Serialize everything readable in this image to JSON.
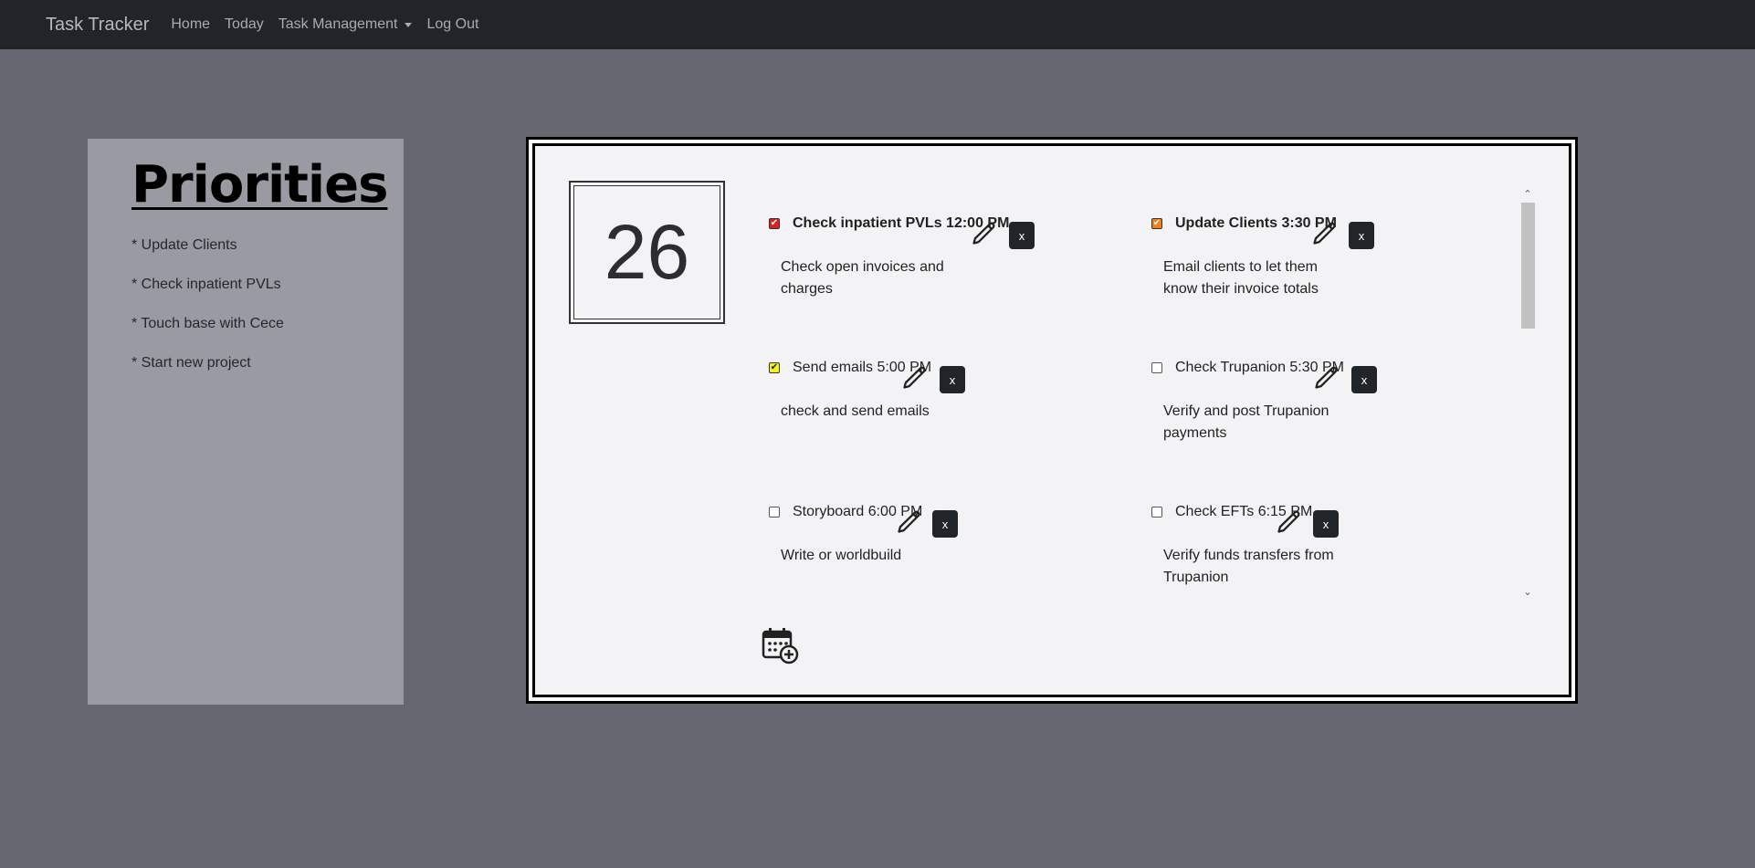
{
  "nav": {
    "brand": "Task Tracker",
    "links": [
      "Home",
      "Today",
      "Task Management",
      "Log Out"
    ]
  },
  "priorities": {
    "title": "Priorities",
    "items": [
      "* Update Clients",
      "* Check inpatient PVLs",
      "* Touch base with Cece",
      "* Start new project"
    ]
  },
  "day": "26",
  "tasks": [
    {
      "title": "Check inpatient PVLs 12:00 PM",
      "desc": "Check open invoices and charges",
      "checked": true,
      "check_color": "#dc1f1f",
      "bold": true
    },
    {
      "title": "Update Clients 3:30 PM",
      "desc": "Email clients to let them know their invoice totals",
      "checked": true,
      "check_color": "#f0801c",
      "bold": true
    },
    {
      "title": "Send emails 5:00 PM",
      "desc": "check and send emails",
      "checked": true,
      "check_color": "#f5f11a",
      "bold": false
    },
    {
      "title": "Check Trupanion 5:30 PM",
      "desc": "Verify and post Trupanion payments",
      "checked": false,
      "check_color": "#ffffff",
      "bold": false
    },
    {
      "title": "Storyboard 6:00 PM",
      "desc": "Write or worldbuild",
      "checked": false,
      "check_color": "#ffffff",
      "bold": false
    },
    {
      "title": "Check EFTs 6:15 PM",
      "desc": "Verify funds transfers from Trupanion",
      "checked": false,
      "check_color": "#ffffff",
      "bold": false
    }
  ],
  "buttons": {
    "delete_label": "x"
  },
  "icons": {
    "edit": "pencil-icon",
    "add": "calendar-add-icon",
    "dropdown": "caret-down-icon"
  },
  "colors": {
    "navbar": "#212429",
    "page_bg": "#676771",
    "sidebar_bg": "#999aa2",
    "board_bg": "#f3f3f5"
  }
}
